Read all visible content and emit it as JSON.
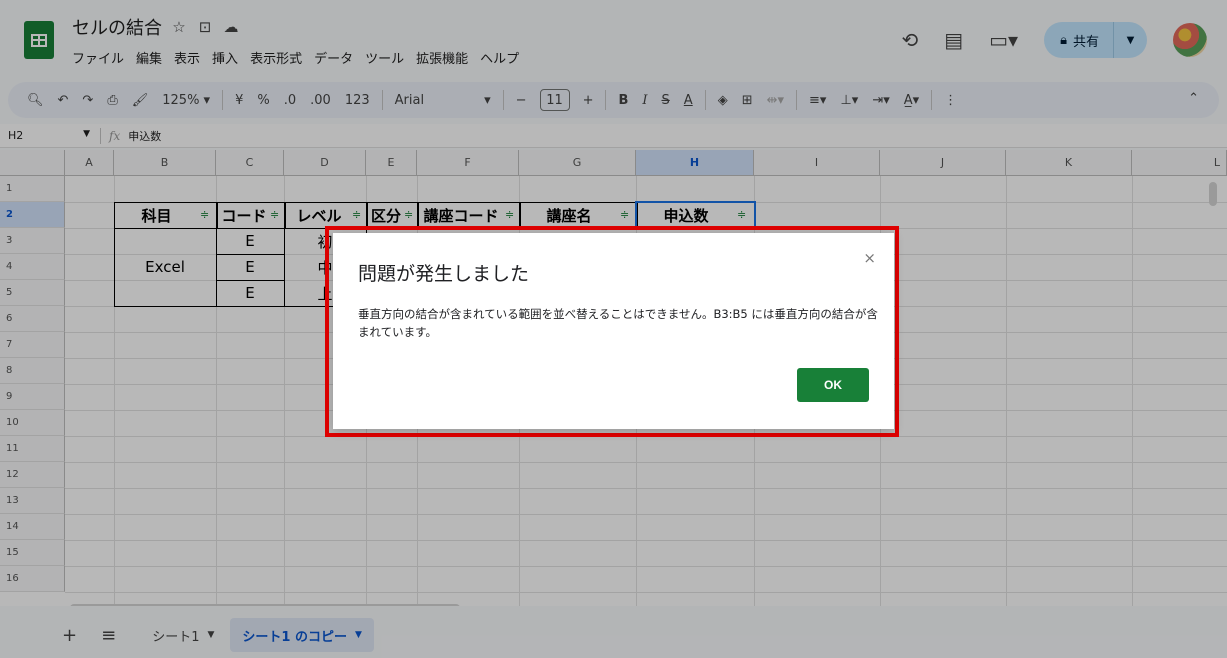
{
  "app": {
    "doc_title": "セルの結合",
    "menus": [
      "ファイル",
      "編集",
      "表示",
      "挿入",
      "表示形式",
      "データ",
      "ツール",
      "拡張機能",
      "ヘルプ"
    ],
    "share_label": "共有"
  },
  "toolbar": {
    "zoom": "125%",
    "currency": "¥",
    "percent": "%",
    "dec_less": ".0",
    "dec_more": ".00",
    "num_format": "123",
    "font": "Arial",
    "font_size": "11"
  },
  "formula_bar": {
    "cell_ref": "H2",
    "content": "申込数"
  },
  "grid": {
    "columns": [
      "A",
      "B",
      "C",
      "D",
      "E",
      "F",
      "G",
      "H",
      "I",
      "J",
      "K",
      "L"
    ],
    "rows": [
      "1",
      "2",
      "3",
      "4",
      "5",
      "6",
      "7",
      "8",
      "9",
      "10",
      "11",
      "12",
      "13",
      "14",
      "15",
      "16"
    ],
    "selected_column": "H",
    "selected_row": "2",
    "header_row": [
      "科目",
      "コード",
      "レベル",
      "区分",
      "講座コード",
      "講座名",
      "申込数"
    ],
    "merged_subject": "Excel",
    "code_values": [
      "E",
      "E",
      "E"
    ],
    "level_values": [
      "初",
      "中",
      "上"
    ]
  },
  "sheets": {
    "tabs": [
      "シート1",
      "シート1 のコピー"
    ],
    "active": "シート1 のコピー"
  },
  "dialog": {
    "title": "問題が発生しました",
    "message": "垂直方向の結合が含まれている範囲を並べ替えることはできません。B3:B5 には垂直方向の結合が含まれています。",
    "ok_label": "OK",
    "close_symbol": "×"
  },
  "colors": {
    "accent_green": "#188038",
    "highlight_red": "#e00000",
    "selection_blue": "#1a73e8"
  }
}
